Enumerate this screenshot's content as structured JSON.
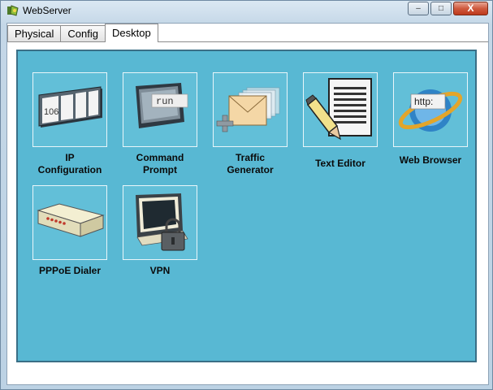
{
  "window": {
    "title": "WebServer",
    "icon": "packet-tracer-icon"
  },
  "controls": {
    "minimize": "–",
    "maximize": "□",
    "close": "X"
  },
  "tabs": [
    {
      "label": "Physical",
      "active": false
    },
    {
      "label": "Config",
      "active": false
    },
    {
      "label": "Desktop",
      "active": true
    }
  ],
  "apps": [
    {
      "label": "IP\nConfiguration",
      "icon": "ip-config-icon",
      "badge": "106"
    },
    {
      "label": "Command\nPrompt",
      "icon": "command-prompt-icon",
      "badge": "run"
    },
    {
      "label": "Traffic\nGenerator",
      "icon": "traffic-generator-icon"
    },
    {
      "label": "Text Editor",
      "icon": "text-editor-icon"
    },
    {
      "label": "Web Browser",
      "icon": "web-browser-icon",
      "badge": "http:"
    },
    {
      "label": "PPPoE Dialer",
      "icon": "pppoe-dialer-icon"
    },
    {
      "label": "VPN",
      "icon": "vpn-icon"
    }
  ],
  "colors": {
    "desktop_bg": "#58b8d3",
    "panel_border": "#3a6f86"
  }
}
